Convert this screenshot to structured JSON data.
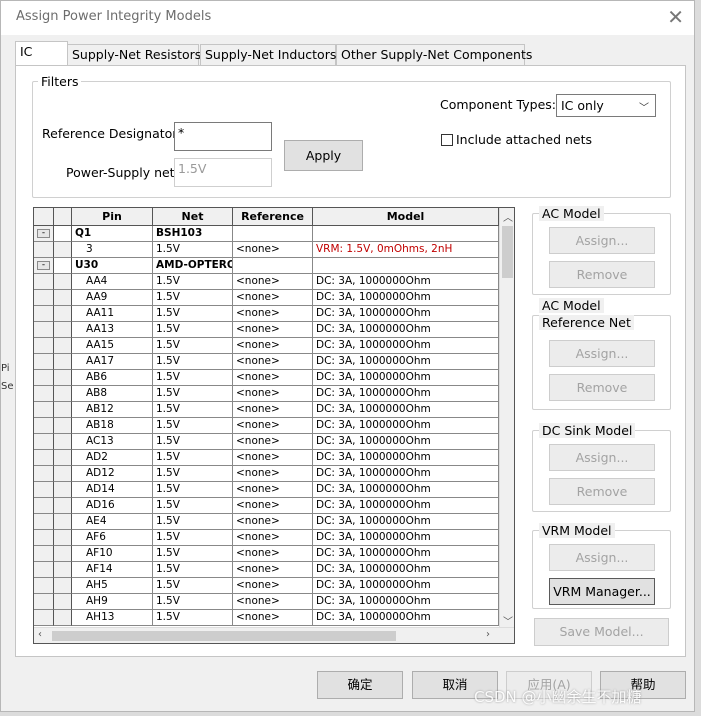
{
  "window": {
    "title": "Assign Power Integrity Models"
  },
  "tabs": [
    {
      "label": "IC",
      "active": true
    },
    {
      "label": "Supply-Net Resistors"
    },
    {
      "label": "Supply-Net Inductors"
    },
    {
      "label": "Other Supply-Net Components"
    }
  ],
  "filters": {
    "group_label": "Filters",
    "component_types_label": "Component Types:",
    "component_types_value": "IC only",
    "include_attached_label": "Include attached nets",
    "ref_designator_label": "Reference Designator:",
    "ref_designator_value": "*",
    "power_net_label": "Power-Supply net:",
    "power_net_value": "1.5V",
    "apply_label": "Apply"
  },
  "table": {
    "columns": [
      "Pin",
      "Net",
      "Reference",
      "Model"
    ],
    "rows": [
      {
        "type": "group",
        "pin": "Q1",
        "net": "BSH103",
        "ref": "",
        "model": ""
      },
      {
        "type": "pin",
        "pin": "3",
        "net": "1.5V",
        "ref": "<none>",
        "model": "VRM: 1.5V, 0mOhms, 2nH",
        "red": true
      },
      {
        "type": "group",
        "pin": "U30",
        "net": "AMD-OPTERO",
        "ref": "",
        "model": ""
      },
      {
        "type": "pin",
        "pin": "AA4",
        "net": "1.5V",
        "ref": "<none>",
        "model": "DC: 3A, 1000000Ohm"
      },
      {
        "type": "pin",
        "pin": "AA9",
        "net": "1.5V",
        "ref": "<none>",
        "model": "DC: 3A, 1000000Ohm"
      },
      {
        "type": "pin",
        "pin": "AA11",
        "net": "1.5V",
        "ref": "<none>",
        "model": "DC: 3A, 1000000Ohm"
      },
      {
        "type": "pin",
        "pin": "AA13",
        "net": "1.5V",
        "ref": "<none>",
        "model": "DC: 3A, 1000000Ohm"
      },
      {
        "type": "pin",
        "pin": "AA15",
        "net": "1.5V",
        "ref": "<none>",
        "model": "DC: 3A, 1000000Ohm"
      },
      {
        "type": "pin",
        "pin": "AA17",
        "net": "1.5V",
        "ref": "<none>",
        "model": "DC: 3A, 1000000Ohm"
      },
      {
        "type": "pin",
        "pin": "AB6",
        "net": "1.5V",
        "ref": "<none>",
        "model": "DC: 3A, 1000000Ohm"
      },
      {
        "type": "pin",
        "pin": "AB8",
        "net": "1.5V",
        "ref": "<none>",
        "model": "DC: 3A, 1000000Ohm"
      },
      {
        "type": "pin",
        "pin": "AB12",
        "net": "1.5V",
        "ref": "<none>",
        "model": "DC: 3A, 1000000Ohm"
      },
      {
        "type": "pin",
        "pin": "AB18",
        "net": "1.5V",
        "ref": "<none>",
        "model": "DC: 3A, 1000000Ohm"
      },
      {
        "type": "pin",
        "pin": "AC13",
        "net": "1.5V",
        "ref": "<none>",
        "model": "DC: 3A, 1000000Ohm"
      },
      {
        "type": "pin",
        "pin": "AD2",
        "net": "1.5V",
        "ref": "<none>",
        "model": "DC: 3A, 1000000Ohm"
      },
      {
        "type": "pin",
        "pin": "AD12",
        "net": "1.5V",
        "ref": "<none>",
        "model": "DC: 3A, 1000000Ohm"
      },
      {
        "type": "pin",
        "pin": "AD14",
        "net": "1.5V",
        "ref": "<none>",
        "model": "DC: 3A, 1000000Ohm"
      },
      {
        "type": "pin",
        "pin": "AD16",
        "net": "1.5V",
        "ref": "<none>",
        "model": "DC: 3A, 1000000Ohm"
      },
      {
        "type": "pin",
        "pin": "AE4",
        "net": "1.5V",
        "ref": "<none>",
        "model": "DC: 3A, 1000000Ohm"
      },
      {
        "type": "pin",
        "pin": "AF6",
        "net": "1.5V",
        "ref": "<none>",
        "model": "DC: 3A, 1000000Ohm"
      },
      {
        "type": "pin",
        "pin": "AF10",
        "net": "1.5V",
        "ref": "<none>",
        "model": "DC: 3A, 1000000Ohm"
      },
      {
        "type": "pin",
        "pin": "AF14",
        "net": "1.5V",
        "ref": "<none>",
        "model": "DC: 3A, 1000000Ohm"
      },
      {
        "type": "pin",
        "pin": "AH5",
        "net": "1.5V",
        "ref": "<none>",
        "model": "DC: 3A, 1000000Ohm"
      },
      {
        "type": "pin",
        "pin": "AH9",
        "net": "1.5V",
        "ref": "<none>",
        "model": "DC: 3A, 1000000Ohm"
      },
      {
        "type": "pin",
        "pin": "AH13",
        "net": "1.5V",
        "ref": "<none>",
        "model": "DC: 3A, 1000000Ohm"
      }
    ]
  },
  "side": {
    "ac_model": {
      "label": "AC Model",
      "assign": "Assign...",
      "remove": "Remove"
    },
    "ac_ref_net": {
      "label_line1": "AC Model",
      "label_line2": "Reference Net",
      "assign": "Assign...",
      "remove": "Remove"
    },
    "dc_sink": {
      "label": "DC Sink Model",
      "assign": "Assign...",
      "remove": "Remove"
    },
    "vrm": {
      "label": "VRM Model",
      "assign": "Assign...",
      "manager": "VRM Manager..."
    },
    "save_model": "Save Model..."
  },
  "bottom": {
    "ok": "确定",
    "cancel": "取消",
    "apply": "应用(A)",
    "help": "帮助"
  },
  "watermark": "CSDN @小幽余生不加糖",
  "background_text": [
    "Pi",
    "Se"
  ]
}
